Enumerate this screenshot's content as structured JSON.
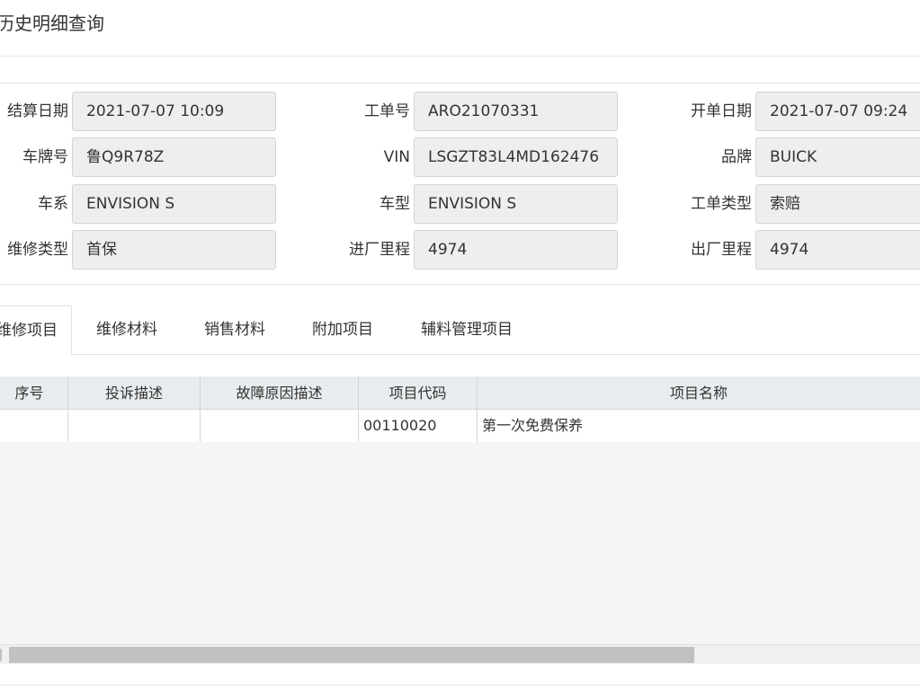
{
  "page": {
    "title": "历史明细查询"
  },
  "form": {
    "row1": {
      "settle_date": {
        "label": "结算日期",
        "value": "2021-07-07 10:09"
      },
      "order_no": {
        "label": "工单号",
        "value": "ARO21070331"
      },
      "open_date": {
        "label": "开单日期",
        "value": "2021-07-07 09:24"
      }
    },
    "row2": {
      "plate": {
        "label": "车牌号",
        "value": "鲁Q9R78Z"
      },
      "vin": {
        "label": "VIN",
        "value": "LSGZT83L4MD162476"
      },
      "brand": {
        "label": "品牌",
        "value": "BUICK"
      }
    },
    "row3": {
      "series": {
        "label": "车系",
        "value": "ENVISION S"
      },
      "model": {
        "label": "车型",
        "value": "ENVISION S"
      },
      "order_type": {
        "label": "工单类型",
        "value": "索赔"
      }
    },
    "row4": {
      "repair_type": {
        "label": "维修类型",
        "value": "首保"
      },
      "in_mileage": {
        "label": "进厂里程",
        "value": "4974"
      },
      "out_mileage": {
        "label": "出厂里程",
        "value": "4974"
      }
    }
  },
  "tabs": [
    {
      "label": "维修项目",
      "active": true
    },
    {
      "label": "维修材料",
      "active": false
    },
    {
      "label": "销售材料",
      "active": false
    },
    {
      "label": "附加项目",
      "active": false
    },
    {
      "label": "辅料管理项目",
      "active": false
    }
  ],
  "grid": {
    "columns": [
      "序号",
      "投诉描述",
      "故障原因描述",
      "项目代码",
      "项目名称"
    ],
    "rows": [
      {
        "seq": "",
        "complaint": "",
        "cause": "",
        "code": "00110020",
        "name": "第一次免费保养"
      }
    ]
  },
  "colors": {
    "input_bg": "#eeeeee",
    "header_bg": "#e9ecee",
    "grid_bg": "#f5f5f5"
  }
}
